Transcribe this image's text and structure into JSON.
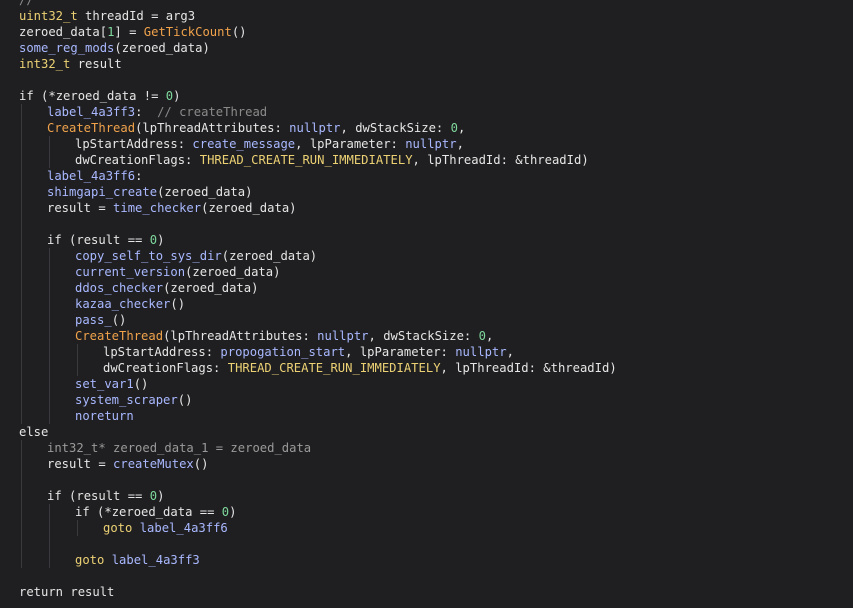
{
  "lines": [
    {
      "indent": 0,
      "tokens": [
        {
          "t": "//",
          "c": "comment"
        }
      ]
    },
    {
      "indent": 0,
      "tokens": [
        {
          "t": "uint32_t",
          "c": "type"
        },
        {
          "t": " threadId = arg3",
          "c": "text"
        }
      ]
    },
    {
      "indent": 0,
      "tokens": [
        {
          "t": "zeroed_data",
          "c": "text"
        },
        {
          "t": "[",
          "c": "text"
        },
        {
          "t": "1",
          "c": "num"
        },
        {
          "t": "] = ",
          "c": "text"
        },
        {
          "t": "GetTickCount",
          "c": "fn-orange"
        },
        {
          "t": "()",
          "c": "text"
        }
      ]
    },
    {
      "indent": 0,
      "tokens": [
        {
          "t": "some_reg_mods",
          "c": "fn"
        },
        {
          "t": "(zeroed_data)",
          "c": "text"
        }
      ]
    },
    {
      "indent": 0,
      "tokens": [
        {
          "t": "int32_t",
          "c": "type"
        },
        {
          "t": " result",
          "c": "text"
        }
      ]
    },
    {
      "indent": 0,
      "tokens": []
    },
    {
      "indent": 0,
      "tokens": [
        {
          "t": "if",
          "c": "kw"
        },
        {
          "t": " (*zeroed_data != ",
          "c": "text"
        },
        {
          "t": "0",
          "c": "num"
        },
        {
          "t": ")",
          "c": "text"
        }
      ]
    },
    {
      "indent": 1,
      "tokens": [
        {
          "t": "label_4a3ff3",
          "c": "label"
        },
        {
          "t": ":  ",
          "c": "text"
        },
        {
          "t": "// createThread",
          "c": "comment"
        }
      ]
    },
    {
      "indent": 1,
      "tokens": [
        {
          "t": "CreateThread",
          "c": "fn-orange"
        },
        {
          "t": "(lpThreadAttributes: ",
          "c": "text"
        },
        {
          "t": "nullptr",
          "c": "nullptr"
        },
        {
          "t": ", dwStackSize: ",
          "c": "text"
        },
        {
          "t": "0",
          "c": "num"
        },
        {
          "t": ",",
          "c": "text"
        }
      ]
    },
    {
      "indent": 2,
      "tokens": [
        {
          "t": "lpStartAddress: ",
          "c": "text"
        },
        {
          "t": "create_message",
          "c": "fn"
        },
        {
          "t": ", lpParameter: ",
          "c": "text"
        },
        {
          "t": "nullptr",
          "c": "nullptr"
        },
        {
          "t": ",",
          "c": "text"
        }
      ]
    },
    {
      "indent": 2,
      "tokens": [
        {
          "t": "dwCreationFlags: ",
          "c": "text"
        },
        {
          "t": "THREAD_CREATE_RUN_IMMEDIATELY",
          "c": "const"
        },
        {
          "t": ", lpThreadId: ",
          "c": "text"
        },
        {
          "t": "&threadId)",
          "c": "text"
        }
      ]
    },
    {
      "indent": 1,
      "tokens": [
        {
          "t": "label_4a3ff6",
          "c": "label"
        },
        {
          "t": ":",
          "c": "text"
        }
      ]
    },
    {
      "indent": 1,
      "tokens": [
        {
          "t": "shimgapi_create",
          "c": "fn"
        },
        {
          "t": "(zeroed_data)",
          "c": "text"
        }
      ]
    },
    {
      "indent": 1,
      "tokens": [
        {
          "t": "result = ",
          "c": "text"
        },
        {
          "t": "time_checker",
          "c": "fn"
        },
        {
          "t": "(zeroed_data)",
          "c": "text"
        }
      ]
    },
    {
      "indent": 0,
      "tokens": []
    },
    {
      "indent": 1,
      "tokens": [
        {
          "t": "if",
          "c": "kw"
        },
        {
          "t": " (result == ",
          "c": "text"
        },
        {
          "t": "0",
          "c": "num"
        },
        {
          "t": ")",
          "c": "text"
        }
      ]
    },
    {
      "indent": 2,
      "tokens": [
        {
          "t": "copy_self_to_sys_dir",
          "c": "fn"
        },
        {
          "t": "(zeroed_data)",
          "c": "text"
        }
      ]
    },
    {
      "indent": 2,
      "tokens": [
        {
          "t": "current_version",
          "c": "fn"
        },
        {
          "t": "(zeroed_data)",
          "c": "text"
        }
      ]
    },
    {
      "indent": 2,
      "tokens": [
        {
          "t": "ddos_checker",
          "c": "fn"
        },
        {
          "t": "(zeroed_data)",
          "c": "text"
        }
      ]
    },
    {
      "indent": 2,
      "tokens": [
        {
          "t": "kazaa_checker",
          "c": "fn"
        },
        {
          "t": "()",
          "c": "text"
        }
      ]
    },
    {
      "indent": 2,
      "tokens": [
        {
          "t": "pass_",
          "c": "fn"
        },
        {
          "t": "()",
          "c": "text"
        }
      ]
    },
    {
      "indent": 2,
      "tokens": [
        {
          "t": "CreateThread",
          "c": "fn-orange"
        },
        {
          "t": "(lpThreadAttributes: ",
          "c": "text"
        },
        {
          "t": "nullptr",
          "c": "nullptr"
        },
        {
          "t": ", dwStackSize: ",
          "c": "text"
        },
        {
          "t": "0",
          "c": "num"
        },
        {
          "t": ",",
          "c": "text"
        }
      ]
    },
    {
      "indent": 3,
      "tokens": [
        {
          "t": "lpStartAddress: ",
          "c": "text"
        },
        {
          "t": "propogation_start",
          "c": "fn"
        },
        {
          "t": ", lpParameter: ",
          "c": "text"
        },
        {
          "t": "nullptr",
          "c": "nullptr"
        },
        {
          "t": ",",
          "c": "text"
        }
      ]
    },
    {
      "indent": 3,
      "tokens": [
        {
          "t": "dwCreationFlags: ",
          "c": "text"
        },
        {
          "t": "THREAD_CREATE_RUN_IMMEDIATELY",
          "c": "const"
        },
        {
          "t": ", lpThreadId: ",
          "c": "text"
        },
        {
          "t": "&threadId)",
          "c": "text"
        }
      ]
    },
    {
      "indent": 2,
      "tokens": [
        {
          "t": "set_var1",
          "c": "fn"
        },
        {
          "t": "()",
          "c": "text"
        }
      ]
    },
    {
      "indent": 2,
      "tokens": [
        {
          "t": "system_scraper",
          "c": "fn"
        },
        {
          "t": "()",
          "c": "text"
        }
      ]
    },
    {
      "indent": 2,
      "tokens": [
        {
          "t": "noreturn",
          "c": "label"
        }
      ]
    },
    {
      "indent": 0,
      "tokens": [
        {
          "t": "else",
          "c": "kw"
        }
      ]
    },
    {
      "indent": 1,
      "tokens": [
        {
          "t": "int32_t* zeroed_data_1 = zeroed_data",
          "c": "dim"
        }
      ]
    },
    {
      "indent": 1,
      "tokens": [
        {
          "t": "result = ",
          "c": "text"
        },
        {
          "t": "createMutex",
          "c": "fn"
        },
        {
          "t": "()",
          "c": "text"
        }
      ]
    },
    {
      "indent": 0,
      "tokens": []
    },
    {
      "indent": 1,
      "tokens": [
        {
          "t": "if",
          "c": "kw"
        },
        {
          "t": " (result == ",
          "c": "text"
        },
        {
          "t": "0",
          "c": "num"
        },
        {
          "t": ")",
          "c": "text"
        }
      ]
    },
    {
      "indent": 2,
      "tokens": [
        {
          "t": "if",
          "c": "kw"
        },
        {
          "t": " (*zeroed_data == ",
          "c": "text"
        },
        {
          "t": "0",
          "c": "num"
        },
        {
          "t": ")",
          "c": "text"
        }
      ]
    },
    {
      "indent": 3,
      "tokens": [
        {
          "t": "goto",
          "c": "const"
        },
        {
          "t": " ",
          "c": "text"
        },
        {
          "t": "label_4a3ff6",
          "c": "label"
        }
      ]
    },
    {
      "indent": 0,
      "tokens": []
    },
    {
      "indent": 2,
      "tokens": [
        {
          "t": "goto",
          "c": "const"
        },
        {
          "t": " ",
          "c": "text"
        },
        {
          "t": "label_4a3ff3",
          "c": "label"
        }
      ]
    },
    {
      "indent": 0,
      "tokens": []
    },
    {
      "indent": 0,
      "tokens": [
        {
          "t": "return",
          "c": "kw"
        },
        {
          "t": " result",
          "c": "text"
        }
      ]
    }
  ],
  "colors": {
    "background": "#1f1f21",
    "text": "#e6e6e6",
    "type": "#ecd174",
    "function": "#a9b8ff",
    "import_function": "#f0a24b",
    "number": "#7ed79c",
    "comment": "#8a8a8a"
  }
}
